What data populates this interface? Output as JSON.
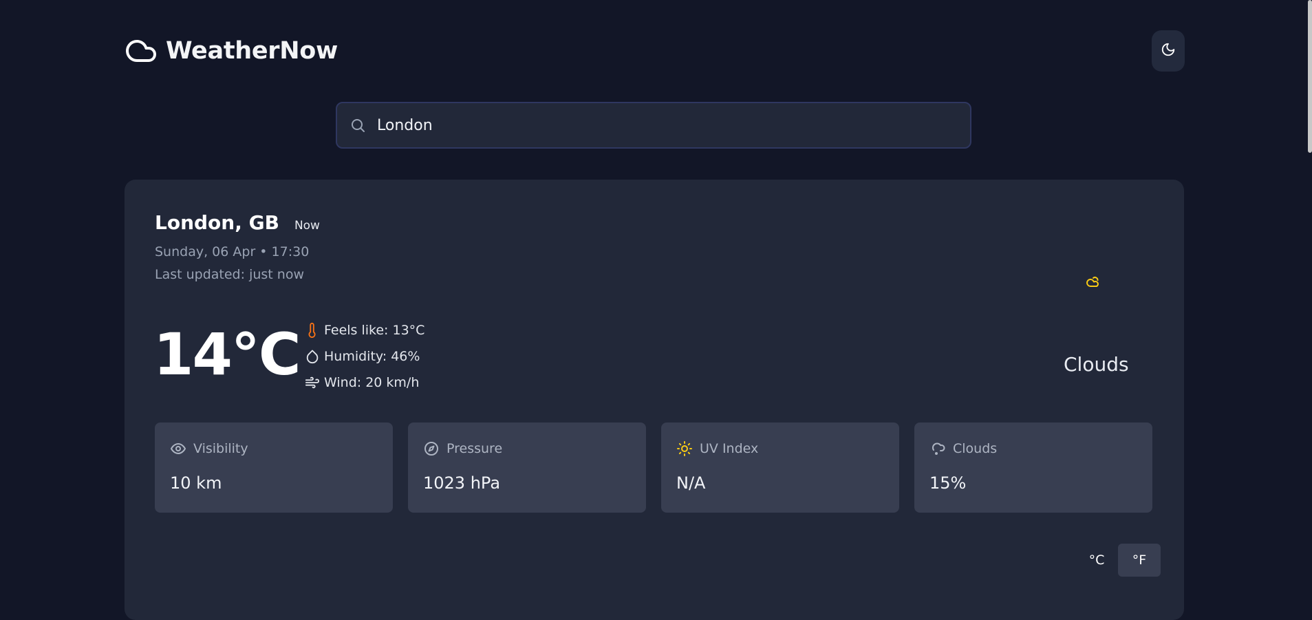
{
  "brand": {
    "name": "WeatherNow"
  },
  "search": {
    "value": "London",
    "placeholder": ""
  },
  "current": {
    "location": "London, GB",
    "badge": "Now",
    "datetime": "Sunday, 06 Apr • 17:30",
    "last_updated": "Last updated: just now",
    "temperature": "14°C",
    "feels_like": "Feels like: 13°C",
    "humidity": "Humidity: 46%",
    "wind": "Wind: 20 km/h",
    "condition": "Clouds"
  },
  "stats": [
    {
      "label": "Visibility",
      "value": "10 km",
      "icon": "eye-icon"
    },
    {
      "label": "Pressure",
      "value": "1023 hPa",
      "icon": "compass-icon"
    },
    {
      "label": "UV Index",
      "value": "N/A",
      "icon": "sun-icon"
    },
    {
      "label": "Clouds",
      "value": "15%",
      "icon": "cloud-rain-icon"
    }
  ],
  "units": {
    "celsius": "°C",
    "fahrenheit": "°F",
    "selected": "°F"
  },
  "colors": {
    "background": "#121627",
    "card": "#222839",
    "tile": "#383e51",
    "accent_orange": "#f97316",
    "accent_yellow": "#facc15"
  }
}
